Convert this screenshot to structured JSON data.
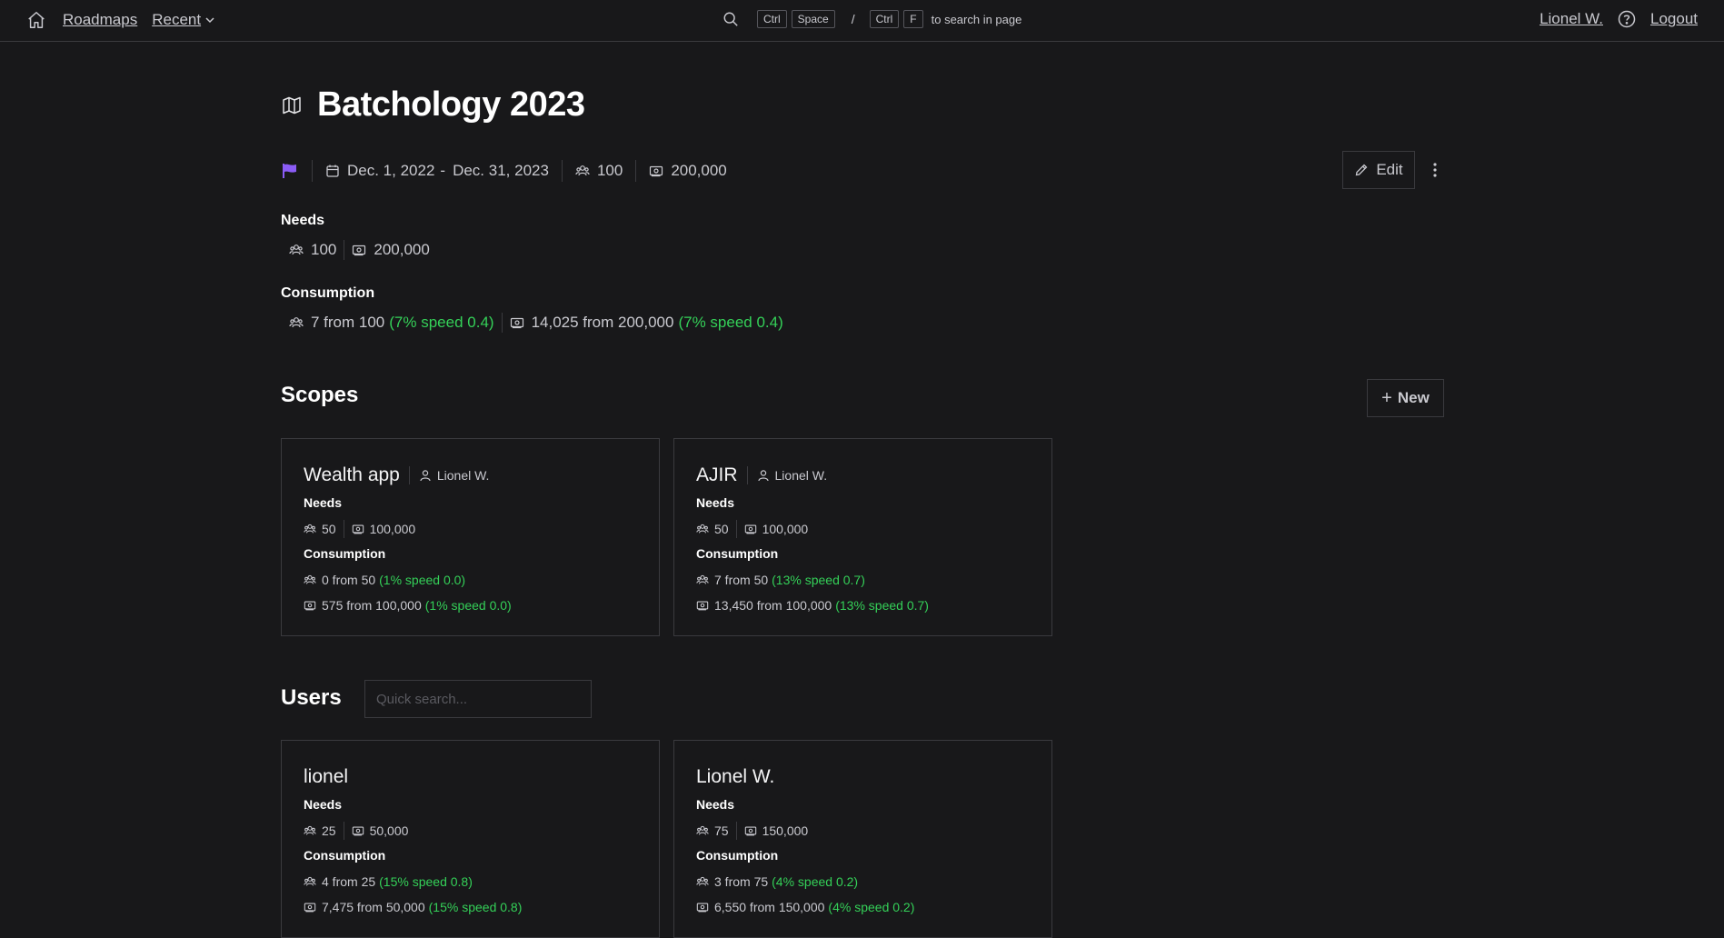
{
  "nav": {
    "roadmaps": "Roadmaps",
    "recent": "Recent",
    "kbd_ctrl1": "Ctrl",
    "kbd_space": "Space",
    "slash": "/",
    "kbd_ctrl2": "Ctrl",
    "kbd_f": "F",
    "search_hint": "to search in page",
    "user": "Lionel W.",
    "logout": "Logout"
  },
  "roadmap": {
    "title": "Batchology 2023",
    "flag_color": "#8b5cf6",
    "date_start": "Dec. 1, 2022",
    "date_dash": "-",
    "date_end": "Dec. 31, 2023",
    "people": "100",
    "budget": "200,000",
    "edit_label": "Edit"
  },
  "needs": {
    "label": "Needs",
    "people": "100",
    "budget": "200,000"
  },
  "consumption": {
    "label": "Consumption",
    "people": "7 from 100",
    "people_speed": "(7% speed 0.4)",
    "budget": "14,025 from 200,000",
    "budget_speed": "(7% speed 0.4)"
  },
  "scopes": {
    "title": "Scopes",
    "new_label": "New",
    "items": [
      {
        "name": "Wealth app",
        "owner": "Lionel W.",
        "needs_label": "Needs",
        "needs_people": "50",
        "needs_budget": "100,000",
        "consumption_label": "Consumption",
        "c_people": "0 from 50",
        "c_people_speed": "(1% speed 0.0)",
        "c_budget": "575 from 100,000",
        "c_budget_speed": "(1% speed 0.0)"
      },
      {
        "name": "AJIR",
        "owner": "Lionel W.",
        "needs_label": "Needs",
        "needs_people": "50",
        "needs_budget": "100,000",
        "consumption_label": "Consumption",
        "c_people": "7 from 50",
        "c_people_speed": "(13% speed 0.7)",
        "c_budget": "13,450 from 100,000",
        "c_budget_speed": "(13% speed 0.7)"
      }
    ]
  },
  "users": {
    "title": "Users",
    "search_placeholder": "Quick search...",
    "items": [
      {
        "name": "lionel",
        "needs_label": "Needs",
        "needs_people": "25",
        "needs_budget": "50,000",
        "consumption_label": "Consumption",
        "c_people": "4 from 25",
        "c_people_speed": "(15% speed 0.8)",
        "c_budget": "7,475 from 50,000",
        "c_budget_speed": "(15% speed 0.8)"
      },
      {
        "name": "Lionel W.",
        "needs_label": "Needs",
        "needs_people": "75",
        "needs_budget": "150,000",
        "consumption_label": "Consumption",
        "c_people": "3 from 75",
        "c_people_speed": "(4% speed 0.2)",
        "c_budget": "6,550 from 150,000",
        "c_budget_speed": "(4% speed 0.2)"
      }
    ]
  }
}
